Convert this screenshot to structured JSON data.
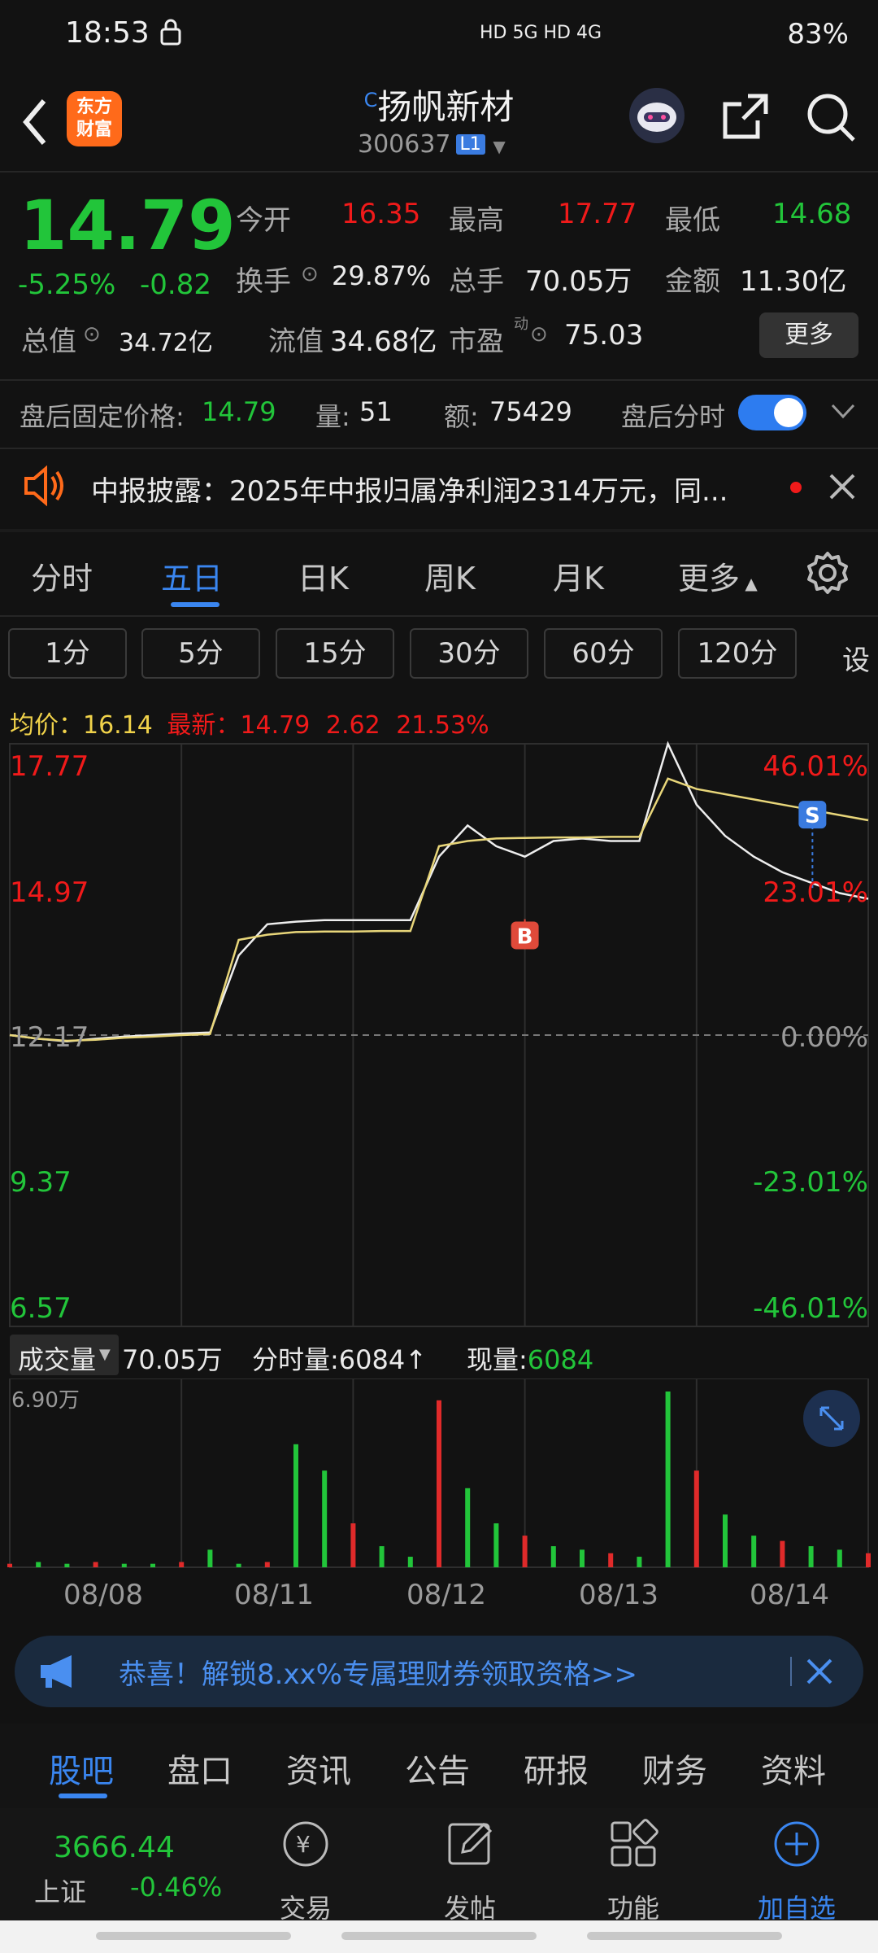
{
  "status_bar": {
    "time": "18:53",
    "indicators": "HD 5G HD 4G",
    "battery": "83%"
  },
  "header": {
    "logo_line1": "东方",
    "logo_line2": "财富",
    "marker": "C",
    "name": "扬帆新材",
    "code": "300637",
    "level": "L1"
  },
  "quote": {
    "price": "14.79",
    "change_pct": "-5.25%",
    "change": "-0.82",
    "open_label": "今开",
    "open": "16.35",
    "high_label": "最高",
    "high": "17.77",
    "low_label": "最低",
    "low": "14.68",
    "turnover_label": "换手",
    "turnover": "29.87%",
    "volume_label": "总手",
    "volume": "70.05万",
    "amount_label": "金额",
    "amount": "11.30亿",
    "mktcap_label": "总值",
    "mktcap": "34.72亿",
    "float_label": "流值",
    "float": "34.68亿",
    "pe_label": "市盈",
    "pe_sup": "动",
    "pe": "75.03",
    "more": "更多"
  },
  "after_hours": {
    "price_label": "盘后固定价格:",
    "price": "14.79",
    "vol_label": "量:",
    "vol": "51",
    "amt_label": "额:",
    "amt": "75429",
    "toggle_label": "盘后分时"
  },
  "notice": {
    "text": "中报披露：2025年中报归属净利润2314万元，同..."
  },
  "tabs": [
    "分时",
    "五日",
    "日K",
    "周K",
    "月K",
    "更多"
  ],
  "periods": [
    "1分",
    "5分",
    "15分",
    "30分",
    "60分",
    "120分",
    "设"
  ],
  "chart_info": {
    "avg_label": "均价：",
    "avg": "16.14",
    "latest_label": "最新：",
    "latest": "14.79",
    "chg": "2.62",
    "chg_pct": "21.53%"
  },
  "chart_data": {
    "type": "line",
    "x": [
      "08/08",
      "08/11",
      "08/12",
      "08/13",
      "08/14"
    ],
    "y_left_ticks": [
      "17.77",
      "14.97",
      "12.17",
      "9.37",
      "6.57"
    ],
    "y_right_ticks": [
      "46.01%",
      "23.01%",
      "0.00%",
      "-23.01%",
      "-46.01%"
    ],
    "ylim": [
      6.57,
      17.77
    ],
    "baseline": 12.17,
    "series": [
      {
        "values": [
          12.17,
          12.1,
          12.05,
          12.1,
          12.14,
          12.17,
          12.2,
          12.22,
          13.7,
          14.3,
          14.35,
          14.38,
          14.38,
          14.38,
          14.38,
          15.6,
          16.2,
          15.8,
          15.6,
          15.9,
          15.95,
          15.9,
          15.9,
          17.77,
          16.6,
          16.0,
          15.6,
          15.3,
          15.1,
          14.9,
          14.79
        ]
      },
      {
        "values": [
          12.17,
          12.1,
          12.06,
          12.08,
          12.12,
          12.14,
          12.17,
          12.19,
          14.0,
          14.1,
          14.15,
          14.16,
          14.16,
          14.17,
          14.17,
          15.8,
          15.9,
          15.95,
          15.96,
          15.97,
          15.97,
          15.98,
          15.98,
          17.1,
          16.9,
          16.8,
          16.7,
          16.6,
          16.5,
          16.4,
          16.3
        ]
      }
    ],
    "markers": [
      {
        "label": "B",
        "price": 14.4
      },
      {
        "label": "S",
        "price": 15.0
      }
    ],
    "grid": true
  },
  "volume_panel": {
    "label": "成交量",
    "total": "70.05万",
    "tick_label": "分时量:",
    "tick": "6084",
    "now_label": "现量:",
    "now": "6084",
    "max": "6.90万",
    "bars": [
      0.02,
      0.03,
      0.02,
      0.03,
      0.02,
      0.02,
      0.03,
      0.1,
      0.02,
      0.03,
      0.7,
      0.55,
      0.25,
      0.12,
      0.06,
      0.95,
      0.45,
      0.25,
      0.18,
      0.12,
      0.1,
      0.08,
      0.06,
      1.0,
      0.55,
      0.3,
      0.18,
      0.15,
      0.12,
      0.1,
      0.08
    ]
  },
  "promo": {
    "text": "恭喜！解锁8.xx%专属理财券领取资格>>"
  },
  "bottom_tabs": [
    "股吧",
    "盘口",
    "资讯",
    "公告",
    "研报",
    "财务",
    "资料"
  ],
  "index": {
    "value": "3666.44",
    "name": "上证",
    "change": "-0.46%"
  },
  "dock": [
    "交易",
    "发帖",
    "功能",
    "加自选"
  ]
}
